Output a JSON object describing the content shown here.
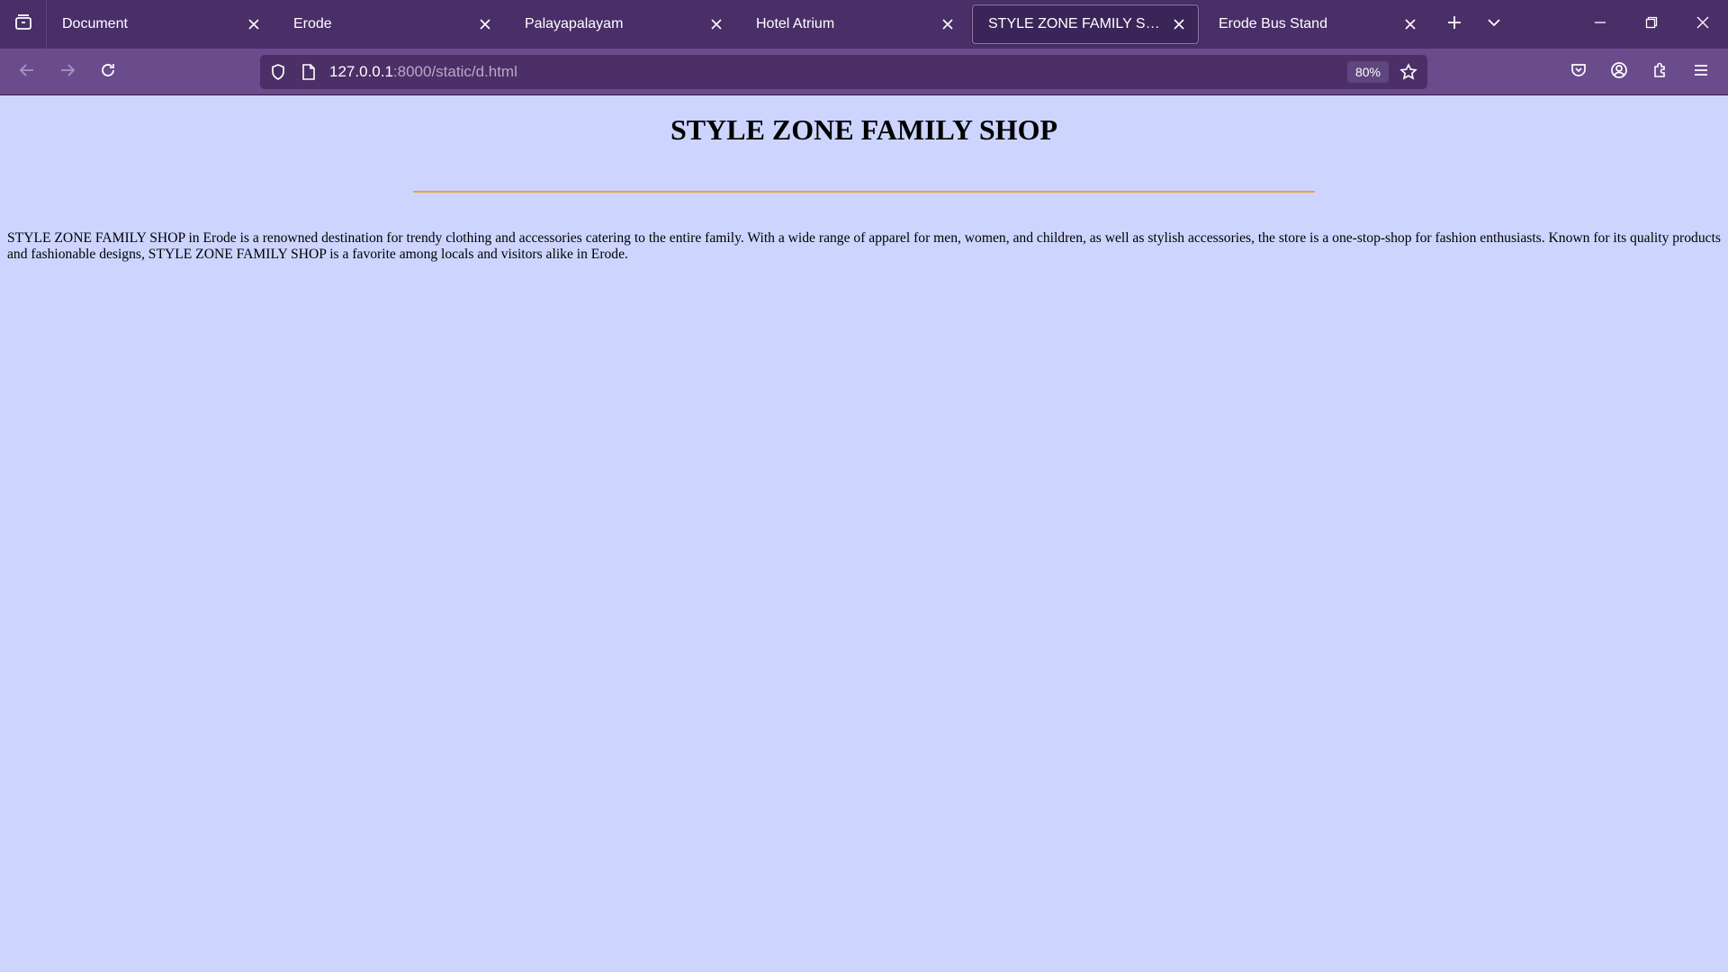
{
  "browser": {
    "tabs": [
      {
        "label": "Document",
        "active": false
      },
      {
        "label": "Erode",
        "active": false
      },
      {
        "label": "Palayapalayam",
        "active": false
      },
      {
        "label": "Hotel Atrium",
        "active": false
      },
      {
        "label": "STYLE ZONE FAMILY SHOP",
        "active": true
      },
      {
        "label": "Erode Bus Stand",
        "active": false
      }
    ],
    "url_host": "127.0.0.1",
    "url_rest": ":8000/static/d.html",
    "zoom": "80%",
    "icons": {
      "tab_list": "tab-list-icon",
      "new_tab": "plus-icon",
      "all_tabs": "chevron-down-icon",
      "back": "arrow-left-icon",
      "forward": "arrow-right-icon",
      "reload": "reload-icon",
      "tracking_protection": "shield-icon",
      "page_info": "page-icon",
      "bookmark": "star-icon",
      "pocket": "pocket-icon",
      "account": "account-icon",
      "extensions": "puzzle-icon",
      "menu": "hamburger-icon"
    },
    "colors": {
      "tabbar": "#4a2e68",
      "navbar": "#6a4b8c",
      "urlbar": "#4b2f66"
    }
  },
  "page": {
    "title": "STYLE ZONE FAMILY SHOP",
    "description": "STYLE ZONE FAMILY SHOP in Erode is a renowned destination for trendy clothing and accessories catering to the entire family. With a wide range of apparel for men, women, and children, as well as stylish accessories, the store is a one-stop-shop for fashion enthusiasts. Known for its quality products and fashionable designs, STYLE ZONE FAMILY SHOP is a favorite among locals and visitors alike in Erode.",
    "colors": {
      "background": "#cdd5fe",
      "rule": "#e8a33a"
    }
  }
}
